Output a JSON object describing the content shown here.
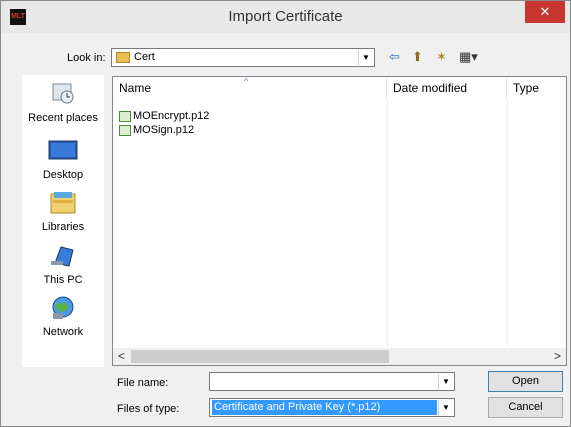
{
  "window": {
    "title": "Import Certificate",
    "app_icon_text": "MLT",
    "close_glyph": "✕"
  },
  "toolbar": {
    "look_in_label": "Look in:",
    "look_in_value": "Cert",
    "back_glyph": "⇦",
    "up_glyph": "⬆",
    "new_folder_glyph": "✶",
    "view_glyph": "▦▾"
  },
  "places": [
    {
      "label": "Recent places",
      "icon": "recent-places-icon"
    },
    {
      "label": "Desktop",
      "icon": "desktop-icon"
    },
    {
      "label": "Libraries",
      "icon": "libraries-icon"
    },
    {
      "label": "This PC",
      "icon": "this-pc-icon"
    },
    {
      "label": "Network",
      "icon": "network-icon"
    }
  ],
  "file_list": {
    "columns": [
      "Name",
      "Date modified",
      "Type"
    ],
    "sort_glyph": "^",
    "files": [
      "MOEncrypt.p12",
      "MOSign.p12"
    ]
  },
  "scroll": {
    "left_glyph": "<",
    "right_glyph": ">"
  },
  "bottom": {
    "file_name_label": "File name:",
    "file_name_value": "",
    "file_type_label": "Files of type:",
    "file_type_value": "Certificate and Private Key (*.p12)",
    "open_label": "Open",
    "cancel_label": "Cancel",
    "dropdown_glyph": "▼"
  }
}
